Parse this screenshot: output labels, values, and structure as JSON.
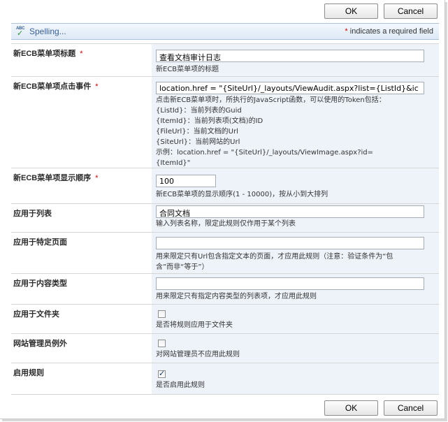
{
  "buttons": {
    "ok": "OK",
    "cancel": "Cancel"
  },
  "toolbar": {
    "spelling_icon_text": "ABC",
    "spelling_label": "Spelling...",
    "required_star": "*",
    "required_note": " indicates a required field"
  },
  "fields": [
    {
      "label": "新ECB菜单项标题",
      "required": "*",
      "value": "查看文档审计日志",
      "description": "新ECB菜单项的标题"
    },
    {
      "label": "新ECB菜单项点击事件",
      "required": "*",
      "value": "location.href = \"{SiteUrl}/_layouts/ViewAudit.aspx?list={ListId}&ic",
      "description": "点击新ECB菜单项时，所执行的JavaScript函数，可以使用的Token包括：\n{ListId}：当前列表的Guid\n{ItemId}：当前列表项(文档)的ID\n{FileUrl}：当前文档的Url\n{SiteUrl}：当前网站的Url\n示例：location.href = \"{SiteUrl}/_layouts/ViewImage.aspx?id=\n{ItemId}\""
    },
    {
      "label": "新ECB菜单项显示顺序",
      "required": "*",
      "value": "100",
      "description": "新ECB菜单项的显示顺序(1 - 10000)，按从小到大排列"
    },
    {
      "label": "应用于列表",
      "value": "合同文档",
      "description": "输入列表名称，限定此规则仅作用于某个列表"
    },
    {
      "label": "应用于特定页面",
      "value": "",
      "description": "用来限定只有Url包含指定文本的页面，才应用此规则（注意：验证条件为“包\n含”而非“等于”）"
    },
    {
      "label": "应用于内容类型",
      "value": "",
      "description": "用来限定只有指定内容类型的列表项，才应用此规则"
    },
    {
      "label": "应用于文件夹",
      "checked": false,
      "description": "是否将规则应用于文件夹"
    },
    {
      "label": "网站管理员例外",
      "checked": false,
      "description": "对网站管理员不应用此规则"
    },
    {
      "label": "启用规则",
      "checked": true,
      "check_mark": "✓",
      "description": "是否启用此规则"
    }
  ]
}
